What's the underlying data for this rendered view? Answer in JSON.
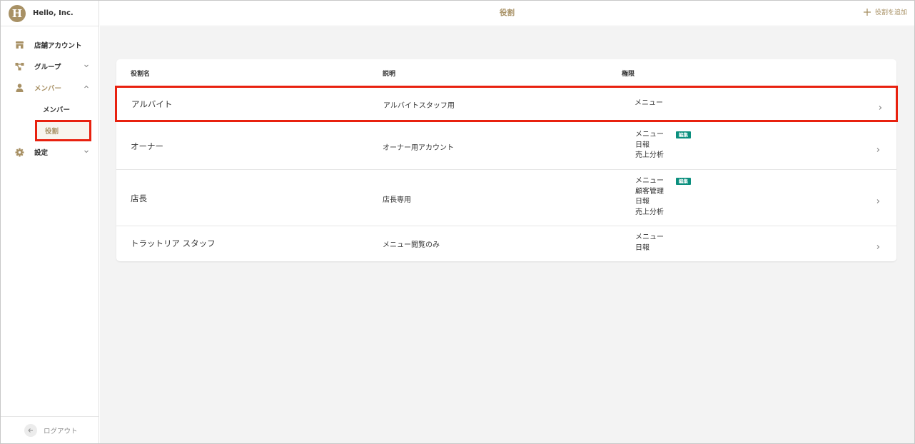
{
  "brand": {
    "logo_letter": "H",
    "name": "Hello, Inc."
  },
  "sidebar": {
    "items": [
      {
        "label": "店舗アカウント",
        "icon": "store-icon"
      },
      {
        "label": "グループ",
        "icon": "group-icon",
        "expandable": true
      },
      {
        "label": "メンバー",
        "icon": "person-icon",
        "expandable": true,
        "expanded": true,
        "children": [
          {
            "label": "メンバー"
          },
          {
            "label": "役割",
            "selected": true
          }
        ]
      },
      {
        "label": "設定",
        "icon": "gear-icon",
        "expandable": true
      }
    ],
    "logout_label": "ログアウト"
  },
  "header": {
    "title": "役割",
    "add_label": "役割を追加"
  },
  "table": {
    "headers": {
      "name": "役割名",
      "description": "説明",
      "permissions": "権限"
    },
    "rows": [
      {
        "name": "アルバイト",
        "description": "アルバイトスタッフ用",
        "permissions": [
          "メニュー"
        ],
        "badge": ""
      },
      {
        "name": "オーナー",
        "description": "オーナー用アカウント",
        "permissions": [
          "メニュー",
          "日報",
          "売上分析"
        ],
        "badge": "編集"
      },
      {
        "name": "店長",
        "description": "店長専用",
        "permissions": [
          "メニュー",
          "顧客管理",
          "日報",
          "売上分析"
        ],
        "badge": "編集"
      },
      {
        "name": "トラットリア スタッフ",
        "description": "メニュー閲覧のみ",
        "permissions": [
          "メニュー",
          "日報"
        ],
        "badge": ""
      }
    ]
  },
  "colors": {
    "accent": "#a89165",
    "highlight": "#e8210f",
    "badge": "#0b8f7e"
  }
}
